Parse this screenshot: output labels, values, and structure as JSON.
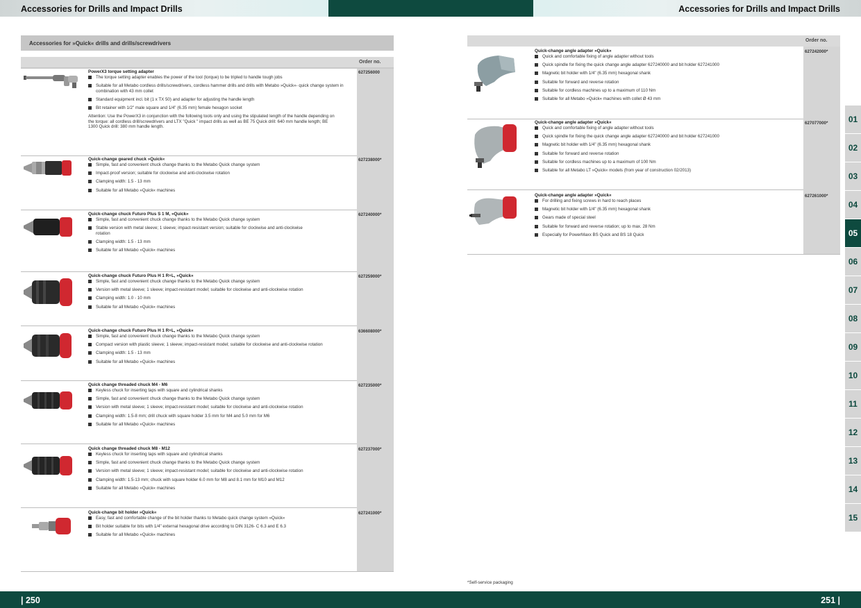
{
  "header": {
    "left_title": "Accessories for Drills and Impact Drills",
    "right_title": "Accessories for Drills and Impact Drills"
  },
  "footer": {
    "left_page": "| 250",
    "right_page": "251 |",
    "footnote": "*Self-service packaging"
  },
  "section_title": "Accessories for »Quick« drills and drills/screwdrivers",
  "order_label": "Order no.",
  "tabs": [
    "01",
    "02",
    "03",
    "04",
    "05",
    "06",
    "07",
    "08",
    "09",
    "10",
    "11",
    "12",
    "13",
    "14",
    "15"
  ],
  "active_tab": "05",
  "left_items": [
    {
      "title": "PowerX3 torque setting adapter",
      "order": "627256000",
      "image": "torque-adapter-image",
      "bullets": [
        "The torque setting adapter enables the power of the tool (torque) to be tripled to handle tough jobs",
        "Suitable for all Metabo cordless drills/screwdrivers, cordless hammer drills and drills with Metabo »Quick«- quick change system in combination with 43 mm collet",
        "Standard equipment incl. bit (1 x TX 50) and adapter for adjusting the handle length",
        "Bit retainer with 1/2\" male square and 1/4\" (6.35 mm) female hexagon socket"
      ],
      "note": "Attention: Use the PowerX3 in conjunction with the following tools only and using the stipulated length of the handle depending on the torque: all cordless drill/screwdrivers and LTX \"Quick \" impact drills as well as BE 75 Quick drill: 640 mm handle length; BE 1300 Quick drill: 380 mm handle length."
    },
    {
      "title": "Quick-change geared chuck »Quick«",
      "order": "627238000*",
      "image": "geared-chuck-image",
      "bullets": [
        "Simple, fast and convenient chuck change thanks to the Metabo Quick change system",
        "Impact-proof version; suitable for clockwise and anti-clockwise rotation",
        "Clamping width: 1.5 - 13 mm",
        "Suitable for all Metabo »Quick« machines"
      ]
    },
    {
      "title": "Quick-change chuck Futuro Plus S 1 M, »Quick«",
      "order": "627240000*",
      "image": "futuro-s1m-chuck-image",
      "bullets": [
        "Simple, fast and convenient chuck change thanks to the Metabo Quick change system",
        "Stable version with metal sleeve; 1 sleeve; impact-resistant version; suitable for clockwise and anti-clockwise rotation",
        "Clamping width: 1.5 - 13 mm",
        "Suitable for all Metabo »Quick« machines"
      ]
    },
    {
      "title": "Quick-change chuck Futuro Plus H 1 R+L, »Quick«",
      "order": "627259000*",
      "image": "futuro-h1-metal-chuck-image",
      "bullets": [
        "Simple, fast and convenient chuck change thanks to the Metabo Quick change system",
        "Version with metal sleeve; 1 sleeve; impact-resistant model; suitable for clockwise and anti-clockwise rotation",
        "Clamping width: 1.0 - 10 mm",
        "Suitable for all Metabo »Quick« machines"
      ]
    },
    {
      "title": "Quick-change chuck Futuro Plus H 1 R+L, »Quick«",
      "order": "636608000*",
      "image": "futuro-h1-plastic-chuck-image",
      "bullets": [
        "Simple, fast and convenient chuck change thanks to the Metabo Quick change system",
        "Compact version with plastic sleeve; 1 sleeve; impact-resistant model; suitable for clockwise and anti-clockwise rotation",
        "Clamping width: 1.5 - 13 mm",
        "Suitable for all Metabo »Quick« machines"
      ]
    },
    {
      "title": "Quick change threaded chuck M4 - M6",
      "order": "627235000*",
      "image": "threaded-chuck-m4-image",
      "bullets": [
        "Keyless chuck for inserting taps with square and cylindrical shanks",
        "Simple, fast and convenient chuck change thanks to the Metabo Quick change system",
        "Version with metal sleeve; 1 sleeve; impact-resistant model; suitable for clockwise and anti-clockwise rotation",
        "Clamping width: 1.5-8 mm; drill chuck with square holder 3.5 mm for M4 and 5.0 mm for M6",
        "Suitable for all Metabo »Quick« machines"
      ]
    },
    {
      "title": "Quick change threaded chuck M8 - M12",
      "order": "627237000*",
      "image": "threaded-chuck-m8-image",
      "bullets": [
        "Keyless chuck for inserting taps with square and cylindrical shanks",
        "Simple, fast and convenient chuck change thanks to the Metabo Quick change system",
        "Version with metal sleeve; 1 sleeve; impact-resistant model; suitable for clockwise and anti-clockwise rotation",
        "Clamping width: 1.5-13 mm; chuck with square holder 6.0 mm for M8 and 8.1 mm for M10 and M12",
        "Suitable for all Metabo »Quick« machines"
      ]
    },
    {
      "title": "Quick-change bit holder »Quick«",
      "order": "627241000*",
      "image": "bit-holder-image",
      "bullets": [
        "Easy, fast and comfortable change of the bit holder thanks to Metabo quick change system »Quick«",
        "Bit holder suitable for bits with 1/4\" external hexagonal drive according to DIN 3126- C 6.3 and E 6.3",
        "Suitable for all Metabo »Quick« machines"
      ]
    }
  ],
  "right_items": [
    {
      "title": "Quick-change angle adapter »Quick«",
      "order": "627242000*",
      "image": "angle-adapter-grey-image",
      "bullets": [
        "Quick and comfortable fixing of angle adapter without tools",
        "Quick spindle for fixing the quick change angle adapter 627240000 and bit holder 627241000",
        "Magnetic bit holder with 1/4\" (6.35 mm) hexagonal shank",
        "Suitable for forward and reverse rotation",
        "Suitable for cordless machines up to a maximum of 110 Nm",
        "Suitable for all Metabo »Quick« machines with collet Ø 43 mm"
      ]
    },
    {
      "title": "Quick-change angle adapter »Quick«",
      "order": "627077000*",
      "image": "angle-adapter-red-image",
      "bullets": [
        "Quick and comfortable fixing of angle adapter without tools",
        "Quick spindle for fixing the quick change angle adapter 627240000 and bit holder 627241000",
        "Magnetic bit holder with 1/4\" (6.35 mm) hexagonal shank",
        "Suitable for forward and reverse rotation",
        "Suitable for cordless machines up to a maximum of 100 Nm",
        "Suitable for all Metabo LT »Quick« models (from year of construction 02/2013)"
      ]
    },
    {
      "title": "Quick-change angle adapter »Quick«",
      "order": "627261000*",
      "image": "angle-adapter-compact-image",
      "bullets": [
        "For drilling and fixing screws in hard to reach places",
        "Magnetic bit holder with 1/4\" (6.35 mm) hexagonal shank",
        "Gears made of special steel",
        "Suitable for forward and reverse rotation; up to max. 28 Nm",
        "Especially for PowerMaxx BS Quick and BS 18 Quick"
      ]
    }
  ]
}
